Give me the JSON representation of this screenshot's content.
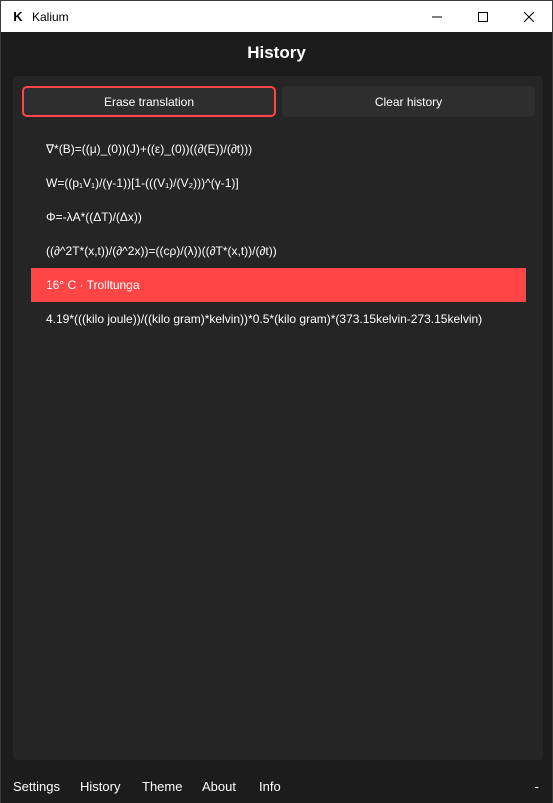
{
  "window": {
    "title": "Kalium",
    "logo": "K",
    "controls": [
      "minimize-icon",
      "maximize-icon",
      "close-icon"
    ]
  },
  "header": {
    "title": "History"
  },
  "toolbar": {
    "erase_label": "Erase translation",
    "clear_label": "Clear history"
  },
  "history": {
    "items": [
      "∇*(B)=((μ)_(0))(J)+((ε)_(0))((∂(E))/(∂t)))",
      "W=((p₁V₁)/(γ-1))[1-(((V₁)/(V₂)))^(γ-1)]",
      "Φ=-λA*((ΔT)/(Δx))",
      "((∂^2T*(x,t))/(∂^2x))=((cρ)/(λ))((∂T*(x,t))/(∂t))",
      "16° C · Trolltunga",
      "4.19*(((kilo joule))/((kilo gram)*kelvin))*0.5*(kilo gram)*(373.15kelvin-273.15kelvin)"
    ],
    "selected_index": 4
  },
  "nav": {
    "settings": "Settings",
    "history": "History",
    "theme": "Theme",
    "about": "About",
    "info": "Info",
    "extra": "-"
  },
  "colors": {
    "accent": "#ff4545",
    "background": "#1c1c1c",
    "panel": "#252525",
    "button": "#2e2e2e"
  }
}
